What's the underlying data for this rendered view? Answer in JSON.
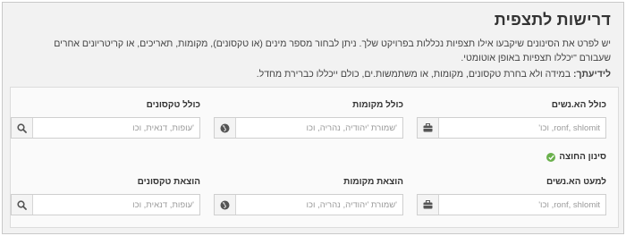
{
  "title": "דרישות לתצפית",
  "intro": "יש לפרט את הסינונים שיקבעו אילו תצפיות נכללות בפרויקט שלך. ניתן לבחור מספר מינים (או טקסונים), מקומות, תאריכים, או קריטריונים אחרים שעבורם \"יכללו תצפיות באופן אוטומטי.",
  "note": {
    "label": "לידיעתך:",
    "text": " במידה ולא בחרת טקסונים, מקומות, או משתמשות.ים, כולם ייכללו כברירת מחדל."
  },
  "include": {
    "people": {
      "label": "כולל הא.נשים",
      "placeholder": "ronf, shlomit, וכו'",
      "icon": "briefcase-icon"
    },
    "places": {
      "label": "כולל מקומות",
      "placeholder": "'שמורת 'יהודיה, נהריה, וכו",
      "icon": "globe-icon"
    },
    "taxa": {
      "label": "כולל טקסונים",
      "placeholder": "'עופות, דנאית, וכו",
      "icon": "search-icon"
    }
  },
  "exclusion_toggle": {
    "label": "סינון החוצה",
    "icon": "check-circle-icon",
    "color": "#6ab04c"
  },
  "exclude": {
    "people": {
      "label": "למעט הא.נשים",
      "placeholder": "ronf, shlomit, וכו'",
      "icon": "briefcase-icon"
    },
    "places": {
      "label": "הוצאת מקומות",
      "placeholder": "'שמורת 'יהודיה, נהריה, וכו",
      "icon": "globe-icon"
    },
    "taxa": {
      "label": "הוצאת טקסונים",
      "placeholder": "'עופות, דנאית, וכו",
      "icon": "search-icon"
    }
  }
}
